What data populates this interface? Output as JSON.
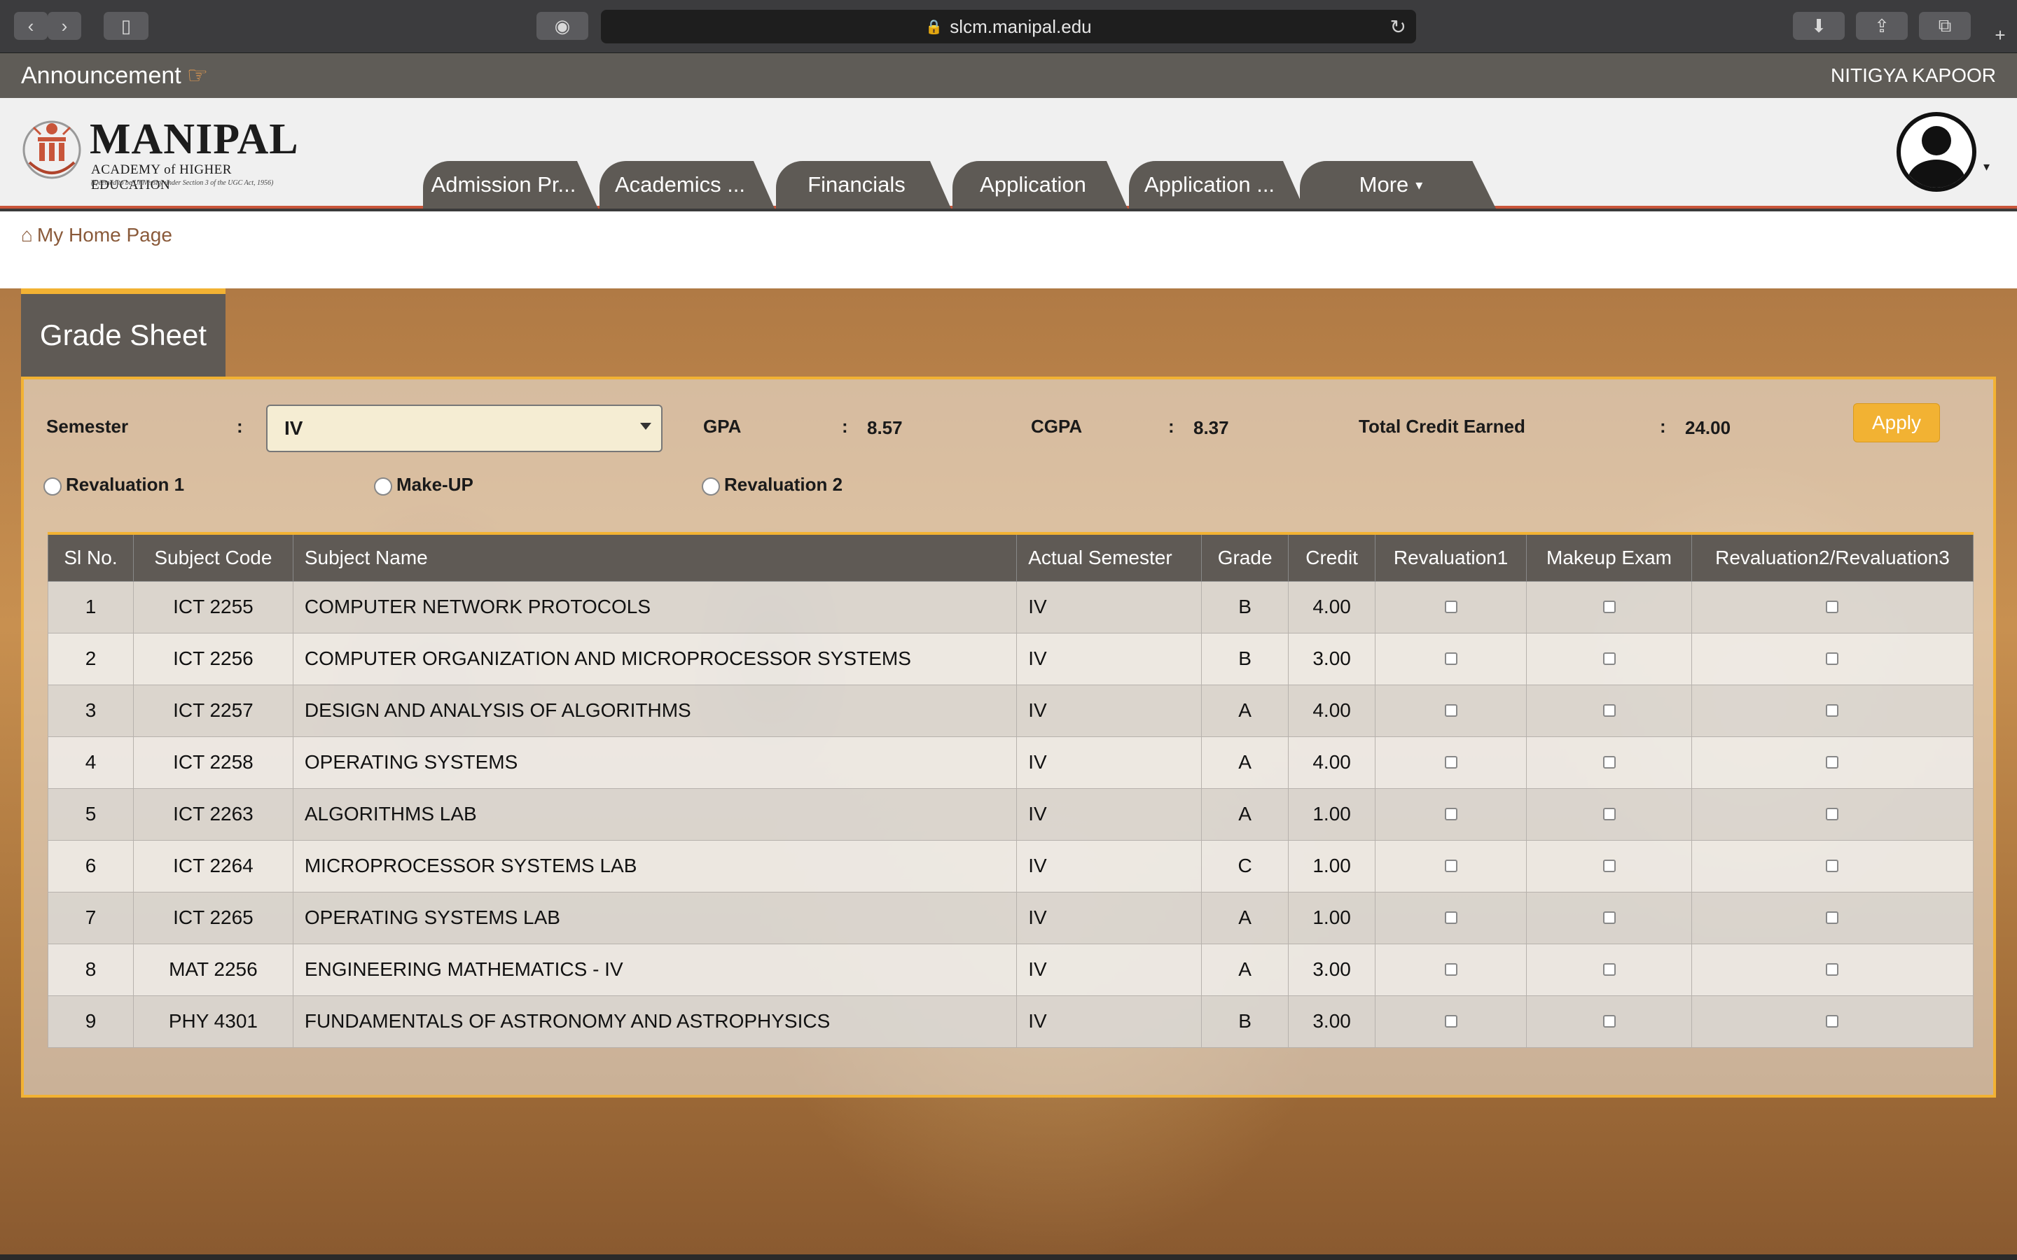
{
  "browser": {
    "url": "slcm.manipal.edu"
  },
  "announcement": {
    "title": "Announcement",
    "user_name": "NITIGYA KAPOOR"
  },
  "logo": {
    "name": "MANIPAL",
    "subtitle": "ACADEMY of HIGHER EDUCATION",
    "note": "(Deemed to be University under Section 3 of the UGC Act, 1956)"
  },
  "nav": {
    "tabs": [
      {
        "label": "Admission Pr..."
      },
      {
        "label": "Academics ..."
      },
      {
        "label": "Financials"
      },
      {
        "label": "Application"
      },
      {
        "label": "Application ..."
      },
      {
        "label": "More"
      }
    ]
  },
  "breadcrumb": {
    "home_label": "My Home Page"
  },
  "grade_sheet": {
    "title": "Grade Sheet",
    "semester_label": "Semester",
    "semester_value": "IV",
    "gpa_label": "GPA",
    "gpa_value": "8.57",
    "cgpa_label": "CGPA",
    "cgpa_value": "8.37",
    "credit_label": "Total Credit Earned",
    "credit_value": "24.00",
    "colon": ":",
    "apply_label": "Apply",
    "radios": [
      {
        "label": "Revaluation 1"
      },
      {
        "label": "Make-UP"
      },
      {
        "label": "Revaluation 2"
      }
    ]
  },
  "table": {
    "headers": [
      "Sl No.",
      "Subject Code",
      "Subject Name",
      "Actual Semester",
      "Grade",
      "Credit",
      "Revaluation1",
      "Makeup Exam",
      "Revaluation2/Revaluation3"
    ],
    "rows": [
      {
        "sl": "1",
        "code": "ICT 2255",
        "name": "COMPUTER NETWORK PROTOCOLS",
        "semester": "IV",
        "grade": "B",
        "credit": "4.00"
      },
      {
        "sl": "2",
        "code": "ICT 2256",
        "name": "COMPUTER ORGANIZATION AND MICROPROCESSOR SYSTEMS",
        "semester": "IV",
        "grade": "B",
        "credit": "3.00"
      },
      {
        "sl": "3",
        "code": "ICT 2257",
        "name": "DESIGN AND ANALYSIS OF ALGORITHMS",
        "semester": "IV",
        "grade": "A",
        "credit": "4.00"
      },
      {
        "sl": "4",
        "code": "ICT 2258",
        "name": "OPERATING SYSTEMS",
        "semester": "IV",
        "grade": "A",
        "credit": "4.00"
      },
      {
        "sl": "5",
        "code": "ICT 2263",
        "name": "ALGORITHMS LAB",
        "semester": "IV",
        "grade": "A",
        "credit": "1.00"
      },
      {
        "sl": "6",
        "code": "ICT 2264",
        "name": "MICROPROCESSOR SYSTEMS LAB",
        "semester": "IV",
        "grade": "C",
        "credit": "1.00"
      },
      {
        "sl": "7",
        "code": "ICT 2265",
        "name": "OPERATING SYSTEMS LAB",
        "semester": "IV",
        "grade": "A",
        "credit": "1.00"
      },
      {
        "sl": "8",
        "code": "MAT 2256",
        "name": "ENGINEERING MATHEMATICS - IV",
        "semester": "IV",
        "grade": "A",
        "credit": "3.00"
      },
      {
        "sl": "9",
        "code": "PHY 4301",
        "name": "FUNDAMENTALS OF ASTRONOMY AND ASTROPHYSICS",
        "semester": "IV",
        "grade": "B",
        "credit": "3.00"
      }
    ]
  },
  "colors": {
    "accent": "#f2b233",
    "header_dark": "#5f5a55",
    "brand_red": "#c8553a"
  },
  "icons": {
    "announcement": "hand-point-right-icon",
    "home": "home-icon",
    "avatar": "user-avatar-icon"
  }
}
